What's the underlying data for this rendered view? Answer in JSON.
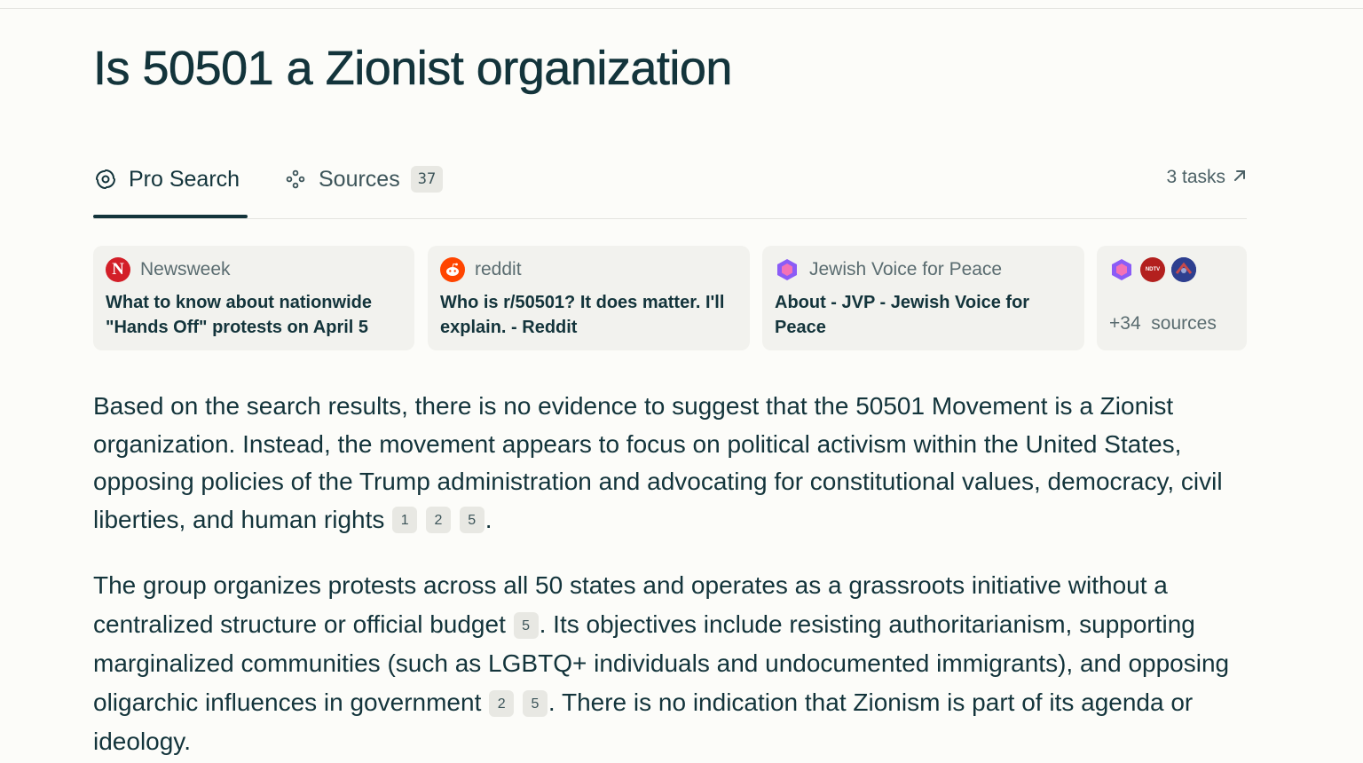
{
  "query": {
    "title": "Is 50501 a Zionist organization"
  },
  "tabs": [
    {
      "label": "Pro Search",
      "icon": "pro-search-icon",
      "active": true
    },
    {
      "label": "Sources",
      "icon": "sources-icon",
      "count": "37",
      "active": false
    }
  ],
  "tasks": {
    "label": "3 tasks",
    "icon": "arrow-up-right-icon"
  },
  "sources": [
    {
      "site": "Newsweek",
      "icon": "newsweek-icon",
      "title": "What to know about nationwide \"Hands Off\" protests on April 5"
    },
    {
      "site": "reddit",
      "icon": "reddit-icon",
      "title": "Who is r/50501? It does matter. I'll explain. - Reddit"
    },
    {
      "site": "Jewish Voice for Peace",
      "icon": "jvp-icon",
      "title": "About - JVP - Jewish Voice for Peace"
    }
  ],
  "more_sources": {
    "icons": [
      "jvp-icon",
      "ndtv-icon",
      "site-icon"
    ],
    "count": "+34",
    "label": "sources",
    "ndtv_text": "NDTV"
  },
  "answer": {
    "p1": {
      "text": "Based on the search results, there is no evidence to suggest that the 50501 Movement is a Zionist organization. Instead, the movement appears to focus on political activism within the United States, opposing policies of the Trump administration and advocating for constitutional values, democracy, civil liberties, and human rights",
      "citations": [
        "1",
        "2",
        "5"
      ],
      "end": "."
    },
    "p2": {
      "s1": "The group organizes protests across all 50 states and operates as a grassroots initiative without a centralized structure or official budget",
      "c1": [
        "5"
      ],
      "s2": ". Its objectives include resisting authoritarianism, supporting marginalized communities (such as LGBTQ+ individuals and undocumented immigrants), and opposing oligarchic influences in government",
      "c2": [
        "2",
        "5"
      ],
      "s3": ". There is no indication that Zionism is part of its agenda or ideology."
    }
  },
  "colors": {
    "background": "#fcfcf9",
    "text": "#13343b",
    "card": "#f2f2ee",
    "newsweek": "#d31f28",
    "reddit": "#ff4500",
    "jvp": "#8b5cf6"
  }
}
